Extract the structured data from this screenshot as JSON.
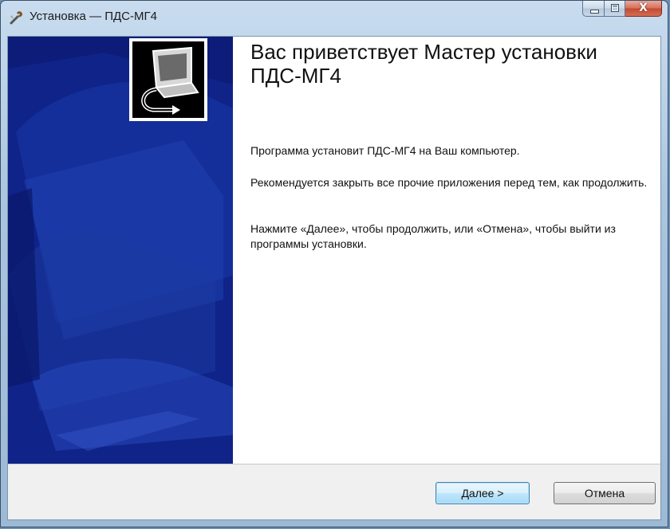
{
  "window": {
    "title": "Установка — ПДС-МГ4",
    "caption_buttons": {
      "minimize": "minimize",
      "maximize": "maximize",
      "close": "X"
    }
  },
  "icons": {
    "app_icon": "wrench-icon",
    "banner_logo": "computer-install-icon"
  },
  "colors": {
    "banner_bg": "#0c1c78",
    "primary_button": "#bee6fd"
  },
  "wizard": {
    "heading": "Вас приветствует Мастер установки ПДС-МГ4",
    "paragraphs": [
      "Программа установит ПДС-МГ4 на Ваш компьютер.",
      "Рекомендуется закрыть все прочие приложения перед тем, как продолжить.",
      "Нажмите «Далее», чтобы продолжить, или «Отмена», чтобы выйти из программы установки."
    ]
  },
  "buttons": {
    "next": "Далее >",
    "cancel": "Отмена"
  }
}
